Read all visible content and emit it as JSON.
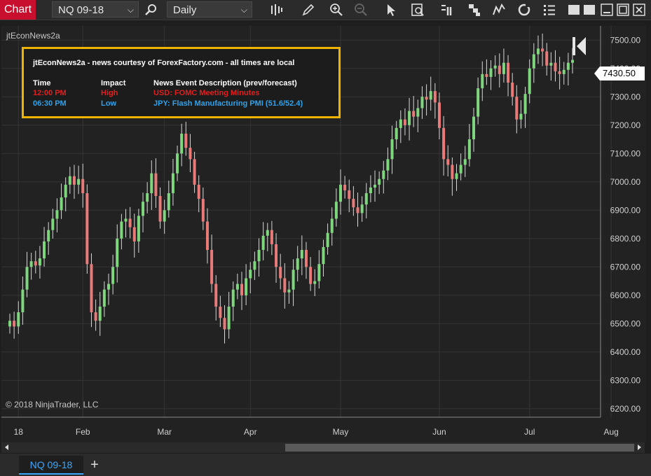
{
  "toolbar": {
    "chart_label": "Chart",
    "instrument": "NQ 09-18",
    "interval": "Daily",
    "icons": [
      "search-icon",
      "bar-type-icon",
      "pencil-icon",
      "zoom-in-icon",
      "zoom-out-icon",
      "pointer-icon",
      "data-box-icon",
      "properties-icon",
      "strategies-icon",
      "indicators-icon",
      "refresh-icon",
      "list-icon",
      "window-icons"
    ]
  },
  "indicator_name": "jtEconNews2a",
  "news": {
    "title": "jtEconNews2a - news courtesy of ForexFactory.com - all times are local",
    "headers": {
      "time": "Time",
      "impact": "Impact",
      "desc": "News Event Description (prev/forecast)"
    },
    "rows": [
      {
        "time": "12:00 PM",
        "impact": "High",
        "desc": "USD: FOMC Meeting Minutes",
        "color": "#e02020"
      },
      {
        "time": "06:30 PM",
        "impact": "Low",
        "desc": "JPY: Flash Manufacturing PMI (51.6/52.4)",
        "color": "#2ea2ea"
      }
    ]
  },
  "copyright": "© 2018 NinjaTrader, LLC",
  "current_price": "7430.50",
  "chart_data": {
    "type": "candlestick",
    "instrument": "NQ 09-18",
    "interval": "Daily",
    "y_ticks": [
      "7500.00",
      "7400.00",
      "7300.00",
      "7200.00",
      "7100.00",
      "7000.00",
      "6900.00",
      "6800.00",
      "6700.00",
      "6600.00",
      "6500.00",
      "6400.00",
      "6300.00",
      "6200.00"
    ],
    "ylim": [
      6170,
      7550
    ],
    "x_ticks": [
      "18",
      "Feb",
      "Mar",
      "Apr",
      "May",
      "Jun",
      "Jul",
      "Aug"
    ],
    "up_color": "#7fd67f",
    "down_color": "#e87a7a",
    "closes": [
      6510,
      6490,
      6540,
      6620,
      6700,
      6720,
      6705,
      6730,
      6790,
      6830,
      6870,
      6900,
      6945,
      6990,
      7020,
      6990,
      7010,
      6960,
      6710,
      6540,
      6510,
      6560,
      6620,
      6640,
      6700,
      6800,
      6860,
      6870,
      6840,
      6790,
      6880,
      6930,
      6960,
      7030,
      6950,
      6860,
      6900,
      6960,
      7030,
      7100,
      7170,
      7120,
      7080,
      6990,
      6940,
      6860,
      6760,
      6640,
      6560,
      6520,
      6480,
      6560,
      6620,
      6640,
      6600,
      6660,
      6690,
      6720,
      6760,
      6810,
      6830,
      6780,
      6700,
      6660,
      6610,
      6620,
      6690,
      6730,
      6760,
      6700,
      6640,
      6650,
      6710,
      6770,
      6820,
      6870,
      6930,
      6990,
      6970,
      6940,
      6910,
      6890,
      6920,
      6960,
      6980,
      6990,
      7010,
      7040,
      7080,
      7150,
      7190,
      7220,
      7200,
      7250,
      7230,
      7260,
      7300,
      7290,
      7320,
      7280,
      7190,
      7080,
      7060,
      7010,
      7030,
      7060,
      7080,
      7150,
      7230,
      7330,
      7380,
      7370,
      7400,
      7410,
      7380,
      7420,
      7350,
      7300,
      7220,
      7240,
      7310,
      7400,
      7450,
      7470,
      7460,
      7410,
      7420,
      7390,
      7380,
      7395,
      7420,
      7430
    ]
  }
}
